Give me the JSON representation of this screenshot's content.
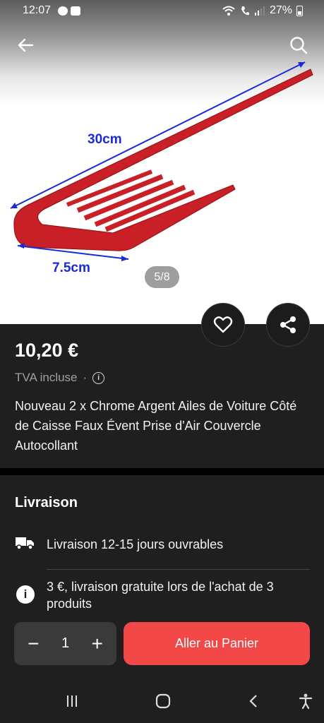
{
  "status_bar": {
    "time": "12:07",
    "battery": "27%"
  },
  "header": {
    "back_icon": "arrow-left-icon",
    "search_icon": "search-icon"
  },
  "gallery": {
    "counter": "5/8",
    "dimension_top": "30cm",
    "dimension_bottom": "7.5cm"
  },
  "product": {
    "price": "10,20 €",
    "tax_label": "TVA incluse",
    "separator": "·",
    "title": "Nouveau 2 x Chrome Argent Ailes de Voiture Côté de Caisse Faux Évent Prise d'Air Couvercle Autocollant"
  },
  "delivery": {
    "heading": "Livraison",
    "time_text": "Livraison 12-15 jours ouvrables",
    "info_text": "3 €, livraison gratuite lors de l'achat de 3 produits"
  },
  "actions": {
    "quantity": "1",
    "minus": "−",
    "plus": "+",
    "cart_label": "Aller au Panier"
  },
  "colors": {
    "accent": "#f24848",
    "background": "#1f1f1f",
    "product_red": "#c91f26"
  }
}
